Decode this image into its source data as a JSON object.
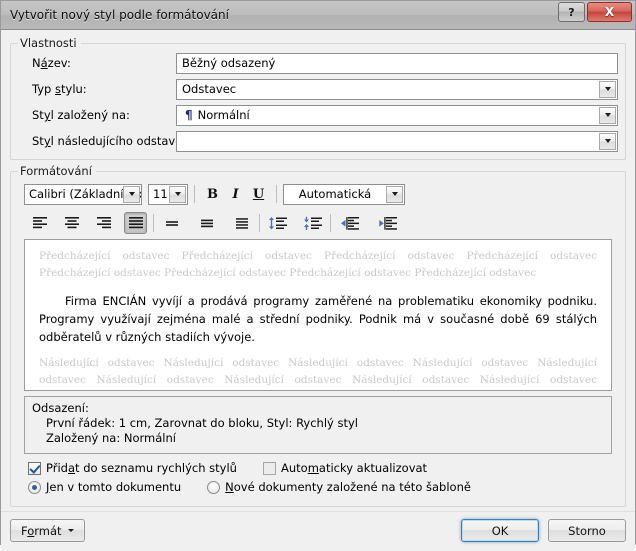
{
  "window": {
    "title": "Vytvořit nový styl podle formátování",
    "help_label": "?",
    "close_label": "X"
  },
  "properties": {
    "legend": "Vlastnosti",
    "name": {
      "label_pre": "N",
      "label_key": "á",
      "label_post": "zev:",
      "value": "Běžný odsazený"
    },
    "style_type": {
      "label_pre": "Typ ",
      "label_key": "s",
      "label_post": "tylu:",
      "value": "Odstavec"
    },
    "based_on": {
      "label_pre": "St",
      "label_key": "y",
      "label_post": "l založený na:",
      "value": "Normální",
      "icon": "pilcrow-icon",
      "icon_glyph": "¶"
    },
    "next_style": {
      "label_pre": "St",
      "label_key": "y",
      "label_post": "l následujícího odstavce:",
      "value": ""
    }
  },
  "formatting": {
    "legend": "Formátování",
    "font_name": "Calibri (Základní tex",
    "font_size": "11",
    "bold_label": "B",
    "italic_label": "I",
    "underline_label": "U",
    "font_color": "Automatická",
    "align_buttons": [
      {
        "name": "align-left-button",
        "pressed": false
      },
      {
        "name": "align-center-button",
        "pressed": false
      },
      {
        "name": "align-right-button",
        "pressed": false
      },
      {
        "name": "align-justify-button",
        "pressed": true
      }
    ],
    "linespacing_buttons": [
      {
        "name": "line-spacing-single-button"
      },
      {
        "name": "line-spacing-1-5-button"
      },
      {
        "name": "line-spacing-double-button"
      }
    ],
    "spacing_buttons": [
      {
        "name": "decrease-paragraph-spacing-button"
      },
      {
        "name": "increase-paragraph-spacing-button"
      }
    ],
    "indent_buttons": [
      {
        "name": "decrease-indent-button"
      },
      {
        "name": "increase-indent-button"
      }
    ]
  },
  "preview": {
    "before_text": "Předcházející odstavec Předcházející odstavec Předcházející odstavec Předcházející odstavec Předcházející odstavec Předcházející odstavec Předcházející odstavec Předcházející odstavec",
    "sample_text": "Firma ENCIÁN vyvíjí a prodává programy zaměřené na problematiku ekonomiky podniku. Programy využívají zejména malé a střední podniky. Podnik má v současné době 69 stálých odběratelů v různých stadiích vývoje.",
    "after_text": "Následující odstavec Následující odstavec Následující odstavec Následující odstavec Následující odstavec Následující odstavec Následující odstavec Následující odstavec Následující odstavec Následující odstavec"
  },
  "description": {
    "line1": "Odsazení:",
    "line2": "První řádek:  1 cm, Zarovnat do bloku, Styl: Rychlý styl",
    "line3": "Založený na: Normální"
  },
  "options": {
    "add_to_quick_styles": {
      "label_pre": "Přid",
      "label_key": "a",
      "label_post": "t do seznamu rychlých stylů",
      "checked": true
    },
    "auto_update": {
      "label_pre": "Auto",
      "label_key": "m",
      "label_post": "aticky aktualizovat",
      "checked": false
    },
    "only_this_document": {
      "label_pre": "",
      "label_key": "J",
      "label_post": "en v tomto dokumentu",
      "selected": true
    },
    "new_documents": {
      "label_pre": "",
      "label_key": "N",
      "label_post": "ové dokumenty založené na této šabloně",
      "selected": false
    }
  },
  "footer": {
    "format_pre": "F",
    "format_key": "o",
    "format_post": "rmát",
    "ok_label": "OK",
    "cancel_label": "Storno"
  },
  "colors": {
    "accent": "#3c7fb1",
    "close_red": "#c2453c",
    "pilcrow_blue": "#1f2a7a",
    "ghost_gray": "#c8c8c8"
  }
}
